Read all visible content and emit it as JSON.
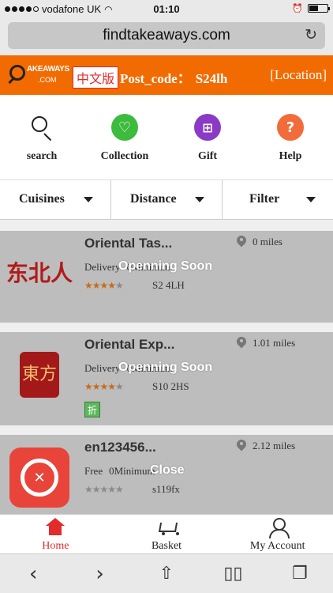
{
  "status_bar": {
    "carrier": "vodafone UK",
    "time": "01:10",
    "signal_bars": "4 of 5",
    "battery_level": 0.4
  },
  "browser": {
    "url": "findtakeaways.com"
  },
  "header": {
    "logo_text_top": "AKEAWAYS",
    "logo_text_bottom": ".COM",
    "lang_button": "中文版",
    "postcode_label": "Post_code：",
    "postcode_value": "S24lh",
    "location_label": "[Location]",
    "brand_color": "#f26b00"
  },
  "actions": [
    {
      "label": "search",
      "icon": "search-icon"
    },
    {
      "label": "Collection",
      "icon": "heart-icon",
      "color": "#3dbb3d"
    },
    {
      "label": "Gift",
      "icon": "gift-icon",
      "color": "#8a3ac4"
    },
    {
      "label": "Help",
      "icon": "help-icon",
      "color": "#f26b3a"
    }
  ],
  "filters": [
    {
      "label": "Cuisines"
    },
    {
      "label": "Distance"
    },
    {
      "label": "Filter"
    }
  ],
  "restaurants": [
    {
      "name": "Oriental Tas...",
      "delivery": "Delivery",
      "minimum": "0Minimum",
      "rating": 4,
      "rating_max": 5,
      "postcode": "S2 4LH",
      "distance": "0 miles",
      "status": "Openning Soon",
      "logo_text": "东北人"
    },
    {
      "name": "Oriental Exp...",
      "delivery": "Delivery",
      "minimum": "0Minimum",
      "rating": 4,
      "rating_max": 5,
      "postcode": "S10 2HS",
      "distance": "1.01 miles",
      "status": "Openning Soon",
      "logo_text": "東方",
      "badge": "折"
    },
    {
      "name": "en123456...",
      "delivery": "Free",
      "minimum": "0Minimum",
      "rating": 0,
      "rating_max": 5,
      "postcode": "s119fx",
      "distance": "2.12 miles",
      "status": "Close"
    }
  ],
  "bottom_nav": [
    {
      "label": "Home",
      "icon": "home-icon",
      "active": true
    },
    {
      "label": "Basket",
      "icon": "basket-icon"
    },
    {
      "label": "My Account",
      "icon": "account-icon"
    }
  ],
  "safari_toolbar": [
    "back-icon",
    "forward-icon",
    "share-icon",
    "bookmarks-icon",
    "tabs-icon"
  ]
}
